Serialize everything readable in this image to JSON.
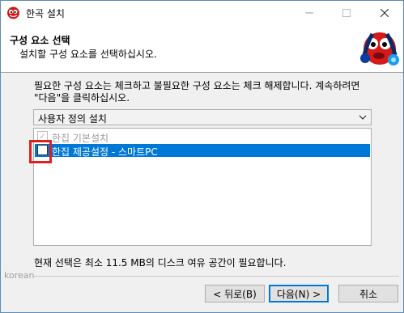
{
  "window": {
    "title": "한곡 설치"
  },
  "header": {
    "title": "구성 요소 선택",
    "subtitle": "설치할 구성 요소를 선택하십시오."
  },
  "description": "필요한 구성 요소는 체크하고 불필요한 구성 요소는 체크 해제합니다. 계속하려면 \"다음\"을 클릭하십시오.",
  "install_type": {
    "selected": "사용자 정의 설치"
  },
  "components": [
    {
      "label": "한집 기본설치",
      "checked": true,
      "disabled": true
    },
    {
      "label": "한집 제공설정 - 스마트PC",
      "checked": false,
      "disabled": false,
      "selected": true
    }
  ],
  "space_required": "현재 선택은 최소 11.5 MB의 디스크 여유 공간이 필요합니다.",
  "brand": "korean",
  "buttons": {
    "back": "< 뒤로(B)",
    "next": "다음(N) >",
    "cancel": "취소"
  },
  "colors": {
    "selection": "#0078d7",
    "highlight_box": "#e02020",
    "header_bg": "#ffffff",
    "body_bg": "#f0f0f0"
  },
  "icons": {
    "app": "mascot-icon",
    "minimize": "minimize-icon",
    "maximize": "maximize-icon",
    "close": "close-icon",
    "dropdown": "chevron-down-icon"
  }
}
